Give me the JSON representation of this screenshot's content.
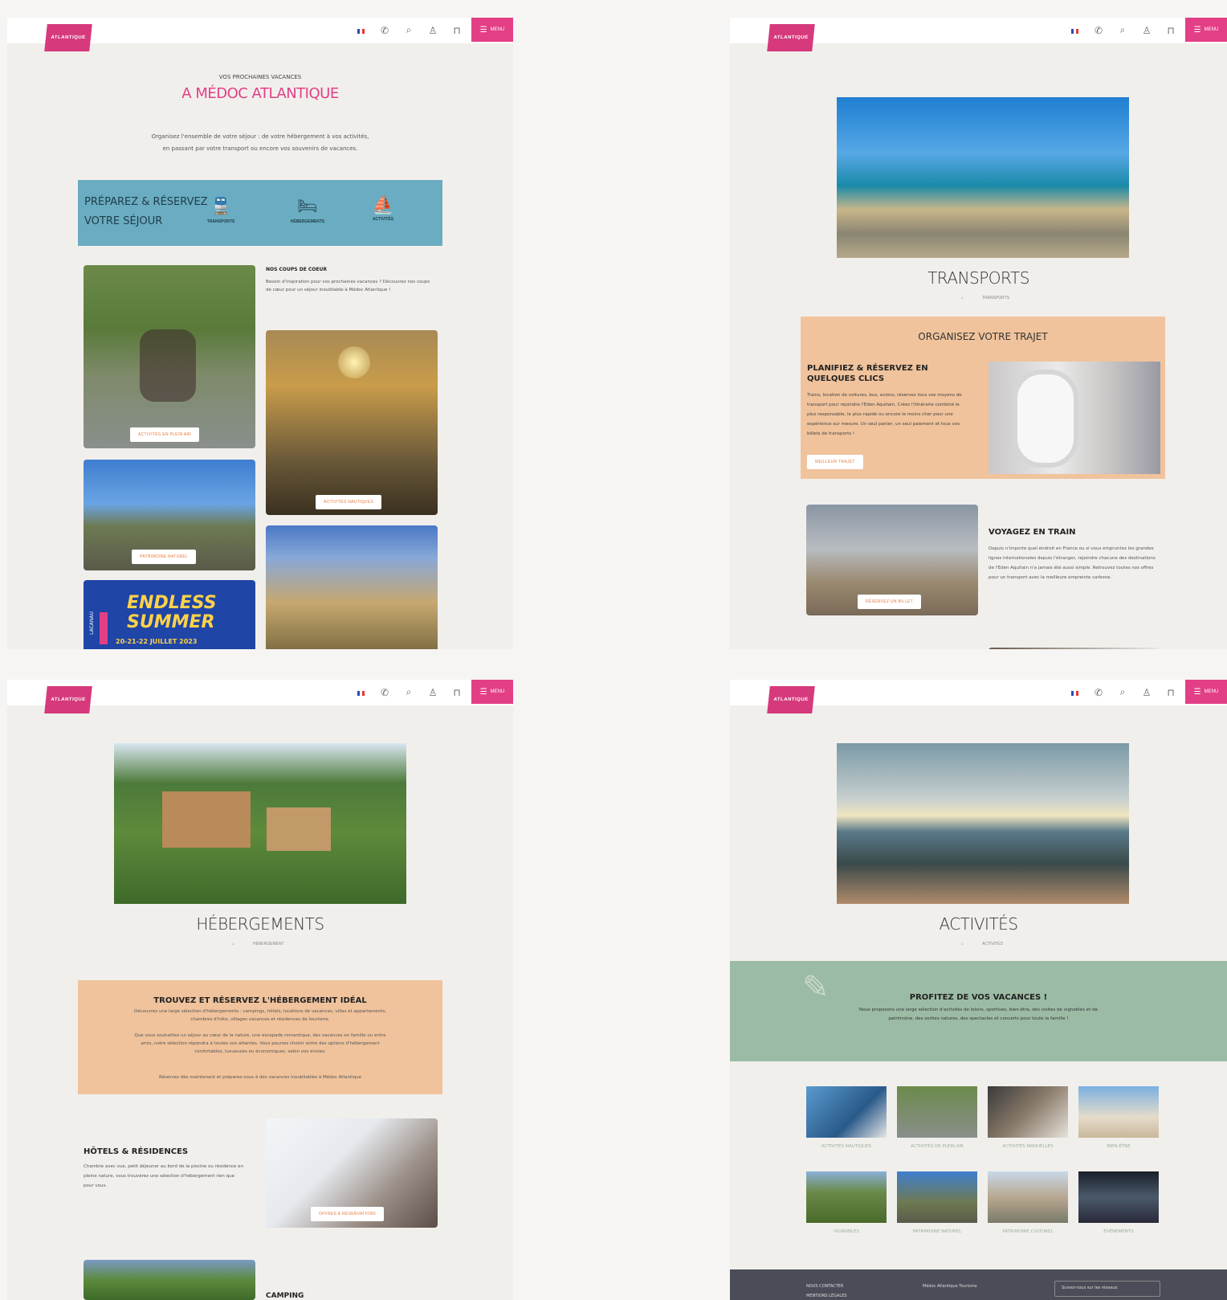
{
  "header": {
    "logo_text": "ATLANTIQUE",
    "menu_label": "MENU",
    "icons": [
      "flag-icon",
      "phone-icon",
      "search-icon",
      "user-icon",
      "basket-icon"
    ]
  },
  "home": {
    "kicker": "VOS PROCHAINES VACANCES",
    "title": "A MÉDOC ATLANTIQUE",
    "intro_line1": "Organisez l'ensemble de votre séjour : de votre hébergement à vos activités,",
    "intro_line2": "en passant par votre transport ou encore vos souvenirs de vacances.",
    "prepare_line1": "PRÉPAREZ & RÉSERVEZ",
    "prepare_line2": "VOTRE SÉJOUR",
    "categories": [
      "TRANSPORTS",
      "HÉBERGEMENTS",
      "ACTIVITÉS"
    ],
    "coups_title": "NOS COUPS DE COEUR",
    "coups_text": "Besoin d'inspiration pour vos prochaines vacances ? Découvrez nos coups de cœur pour un séjour inoubliable à Médoc Atlantique !",
    "btn_plein_air": "ACTIVITÉS EN PLEIN AIR",
    "btn_nautiques": "ACTIVITÉS NAUTIQUES",
    "btn_patrimoine": "PATRIMOINE NATUREL",
    "promo_line1": "ENDLESS",
    "promo_line2": "SUMMER",
    "promo_side": "LACANAU",
    "promo_dates": "20-21-22 JUILLET 2023"
  },
  "transports": {
    "title": "TRANSPORTS",
    "breadcrumb": "TRANSPORTS",
    "organise": "ORGANISEZ VOTRE TRAJET",
    "plan_title": "PLANIFIEZ & RÉSERVEZ EN QUELQUES CLICS",
    "plan_text": "Trains, location de voitures, bus, avions, réservez tous vos moyens de transport pour rejoindre l'Eden Aquitain. Créez l'itinéraire combiné le plus responsable, le plus rapide ou encore le moins cher pour une expérience sur mesure. Un seul panier, un seul paiement et tous vos billets de transports !",
    "plan_btn": "MEILLEUR TRAJET",
    "train_title": "VOYAGEZ EN TRAIN",
    "train_text": "Depuis n'importe quel endroit en France ou si vous empruntez les grandes lignes internationales depuis l'étranger, rejoindre chacune des destinations de l'Eden Aquitain n'a jamais été aussi simple. Retrouvez toutes nos offres pour un transport avec la meilleure empreinte carbone.",
    "train_btn": "RÉSERVEZ UN BILLET"
  },
  "hebergements": {
    "title": "HÉBERGEMENTS",
    "breadcrumb": "HÉBERGEMENT",
    "box_title": "TROUVEZ ET RÉSERVEZ L'HÉBERGEMENT IDÉAL",
    "p1": "Découvrez une large sélection d'hébergements : campings, hôtels, locations de vacances, villas et appartements, chambres d'hôte, villages vacances et résidences de tourisme.",
    "p2": "Que vous souhaitiez un séjour au cœur de la nature, une escapade romantique, des vacances en famille ou entre amis, notre sélection répondra à toutes vos attentes. Vous pourrez choisir entre des options d'hébergement confortables, luxueuses ou économiques, selon vos envies.",
    "p3": "Réservez dès maintenant et préparez-vous à des vacances inoubliables à Médoc Atlantique",
    "hotels_title": "HÔTELS & RÉSIDENCES",
    "hotels_text": "Chambre avec vue, petit déjeuner au bord de la piscine ou résidence en pleine nature, vous trouverez une sélection d'hébergement rien que pour vous.",
    "hotels_btn": "OFFRES & RÉSERVATIONS",
    "camping_title": "CAMPING"
  },
  "activites": {
    "title": "ACTIVITÉS",
    "breadcrumb": "ACTIVITÉS",
    "box_title": "PROFITEZ DE VOS VACANCES !",
    "box_text": "Nous proposons une large sélection d'activités de loisirs, sportives, bien-être, des visites de vignobles et de patrimoine, des sorties natures, des spectacles et concerts pour toute la famille !",
    "tiles_row1": [
      "ACTIVITÉS NAUTIQUES",
      "ACTIVITÉS DE PLEIN AIR",
      "ACTIVITÉS MANUELLES",
      "BIEN-ÊTRE"
    ],
    "tiles_row2": [
      "VIGNOBLES",
      "PATRIMOINE NATUREL",
      "PATRIMOINE CULTUREL",
      "ÉVÉNEMENTS"
    ],
    "footer_col1": "NOUS CONTACTER",
    "footer_col1b": "MENTIONS LÉGALES",
    "footer_col2": "Médoc Atlantique Tourisme",
    "footer_col3": "Suivez-nous sur les réseaux"
  }
}
